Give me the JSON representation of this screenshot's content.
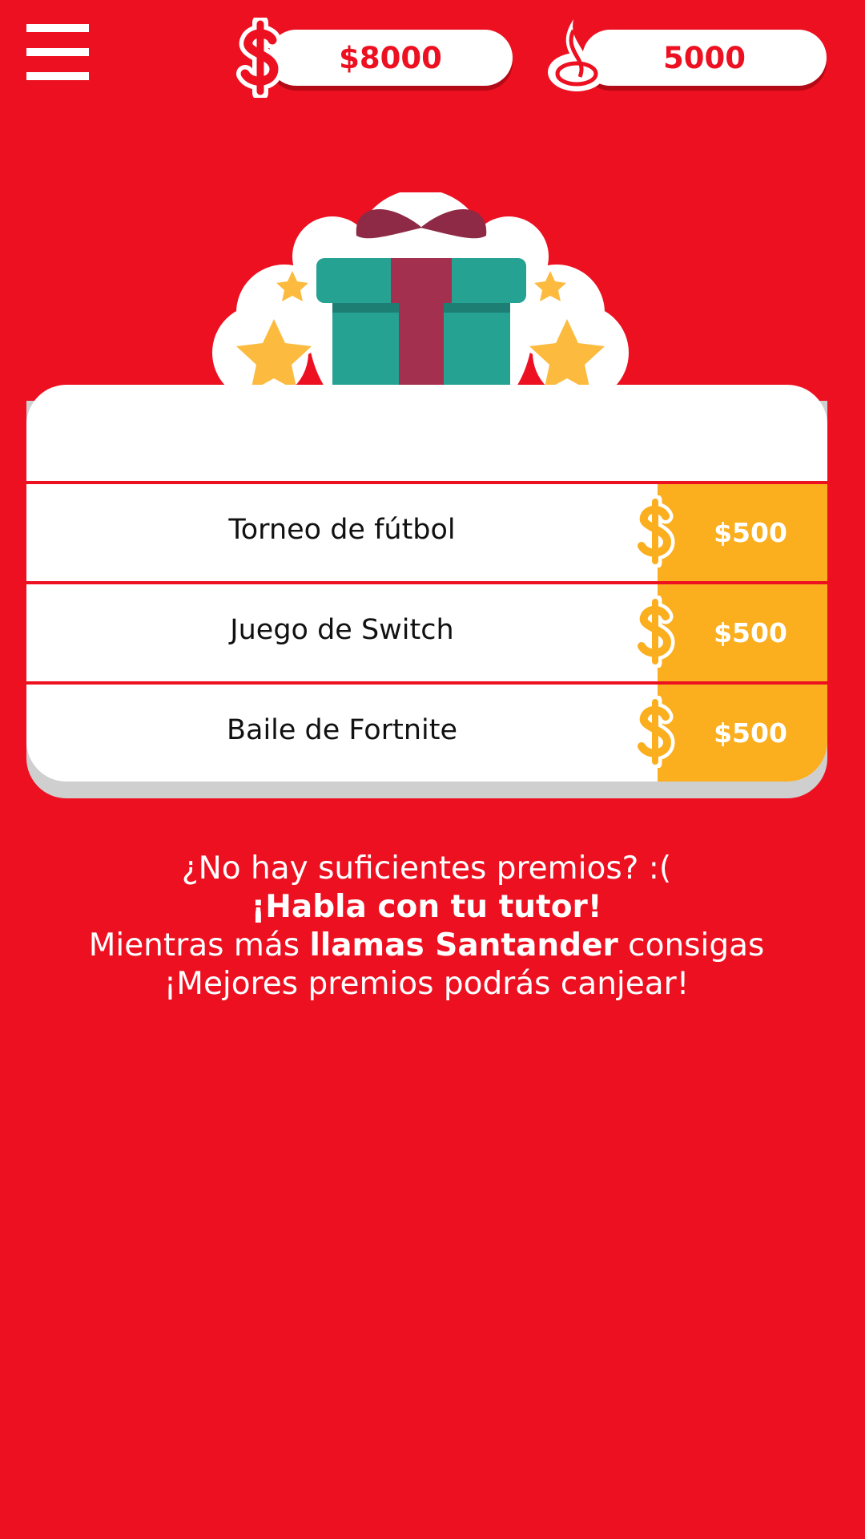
{
  "header": {
    "menu_icon": "hamburger-menu-icon",
    "money": {
      "icon": "dollar-icon",
      "value": "$8000"
    },
    "points": {
      "icon": "santander-flame-icon",
      "value": "5000"
    }
  },
  "illustration": {
    "icon": "gift-box-with-stars-icon",
    "colors": {
      "box": "#26A293",
      "ribbon": "#A3304E",
      "stars": "#FCBB3E"
    }
  },
  "prizes": [
    {
      "name": "Torneo de fútbol",
      "price": "$500",
      "coin_icon": "dollar-icon"
    },
    {
      "name": "Juego de Switch",
      "price": "$500",
      "coin_icon": "dollar-icon"
    },
    {
      "name": "Baile de Fortnite",
      "price": "$500",
      "coin_icon": "dollar-icon"
    }
  ],
  "message": {
    "line1": "¿No hay suficientes premios? :(",
    "line2": "¡Habla con tu tutor!",
    "line3_pre": "Mientras más ",
    "line3_bold": "llamas Santander",
    "line3_post": " consigas",
    "line4": "¡Mejores premios podrás canjear!"
  },
  "colors": {
    "background": "#ED1021",
    "price_band": "#FBAE1E",
    "card": "#FFFFFF"
  }
}
